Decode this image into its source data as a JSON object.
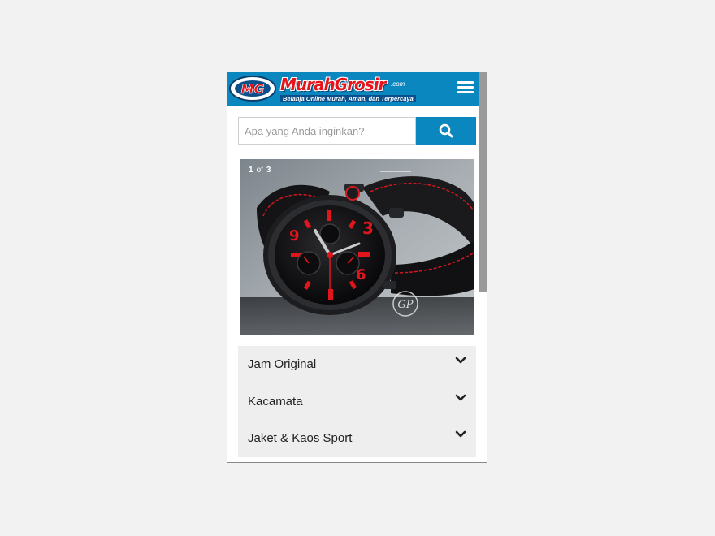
{
  "header": {
    "logo_badge": "MG",
    "logo_name": "MurahGrosir",
    "logo_com": ".com",
    "logo_tagline": "Belanja Online Murah, Aman, dan Terpercaya",
    "brand_color": "#0b87c0",
    "logo_color": "#e8141b",
    "menu_icon": "hamburger-icon"
  },
  "search": {
    "placeholder": "Apa yang Anda inginkan?",
    "value": "",
    "button_icon": "search-icon"
  },
  "slider": {
    "current": "1",
    "of_label": "of",
    "total": "3",
    "slide_subject": "black and red chronograph wristwatch",
    "watermark_signature": "GP"
  },
  "categories": [
    {
      "label": "Jam Original",
      "icon": "chevron-down-icon"
    },
    {
      "label": "Kacamata",
      "icon": "chevron-down-icon"
    },
    {
      "label": "Jaket & Kaos Sport",
      "icon": "chevron-down-icon"
    }
  ]
}
